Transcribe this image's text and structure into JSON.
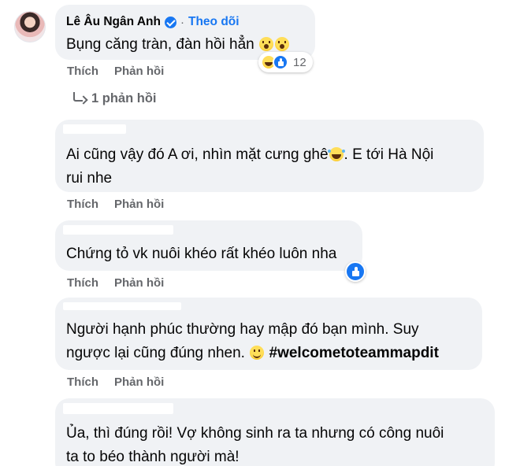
{
  "comments": [
    {
      "author": "Lê Âu Ngân Anh",
      "follow_label": "Theo dõi",
      "separator": "·",
      "text": "Bụng căng tràn, đàn hồi hẳn",
      "reaction_count": "12",
      "like_label": "Thích",
      "reply_label": "Phản hồi",
      "replies_link": "1 phản hồi"
    },
    {
      "text_part1": "Ai cũng vậy đó A ơi, nhìn mặt cưng ghê",
      "text_part2": ". E tới Hà Nội",
      "text_line2": "rui nhe",
      "like_label": "Thích",
      "reply_label": "Phản hồi"
    },
    {
      "text": "Chứng tỏ vk nuôi khéo rất khéo luôn nha",
      "like_label": "Thích",
      "reply_label": "Phản hồi"
    },
    {
      "text_line1": "Người hạnh phúc thường hay mập đó bạn mình. Suy",
      "text_line2": "ngược lại cũng đúng nhen.",
      "hashtag": "#welcometoteammapdit",
      "like_label": "Thích",
      "reply_label": "Phản hồi"
    },
    {
      "text_line1": "Ủa, thì đúng rồi! Vợ không sinh ra ta nhưng có công nuôi",
      "text_line2": "ta to béo thành người mà!"
    }
  ],
  "icons": {
    "verified": "verified-badge-icon",
    "emoji_shock": "astonished-face-icon",
    "emoji_laugh": "rolling-laughing-face-icon",
    "emoji_smile": "smiling-face-icon",
    "reaction_haha": "haha-reaction-icon",
    "reaction_like": "like-reaction-icon",
    "reply_arrow": "reply-arrow-icon"
  },
  "colors": {
    "bubble": "#f0f2f5",
    "accent": "#1877f2",
    "secondary_text": "#65676b"
  }
}
